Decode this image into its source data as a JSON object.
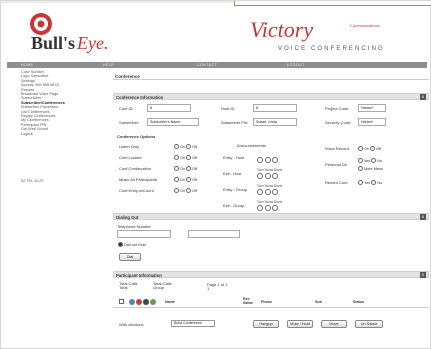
{
  "brand": {
    "logo_text": "Bull's Eye.",
    "partner_name": "Victory",
    "partner_tagline": "Communications",
    "partner_sub": "VOICE CONFERENCING",
    "accent_color": "#cc3333"
  },
  "nav": {
    "items": [
      "HOME",
      "HELP",
      "CONTACT",
      "LOGOUT"
    ]
  },
  "sidebar": {
    "items": [
      {
        "label": "Cust. Scratch",
        "selected": false
      },
      {
        "label": "Logo Subscriber",
        "selected": false
      },
      {
        "label": "Settings",
        "selected": false
      },
      {
        "label": "Access: 800 555 5678",
        "selected": false
      },
      {
        "label": "Reports",
        "selected": false
      },
      {
        "label": "Broadcast Voice Page",
        "selected": false
      },
      {
        "label": "Subscribers",
        "selected": false
      },
      {
        "label": "Subscriber/Conferences",
        "selected": true
      },
      {
        "label": "Subscriber Processes",
        "selected": false
      },
      {
        "label": "List Conferences",
        "selected": false
      },
      {
        "label": "Replay Conferences",
        "selected": false
      },
      {
        "label": "My Conferences",
        "selected": false
      },
      {
        "label": "Participant PIN",
        "selected": false
      },
      {
        "label": "Get Web Sound",
        "selected": false
      },
      {
        "label": "Logout",
        "selected": false
      }
    ],
    "status": "02 TEL 10-07"
  },
  "page": {
    "title": "Conference"
  },
  "conference_info": {
    "header": "Conference Information",
    "toggle": "x",
    "conf_id_label": "Conf ID:",
    "conf_id_value": "8",
    "host_id_label": "Host ID:",
    "host_id_value": "8",
    "project_code_label": "Project Code:",
    "project_code_value": "Harlan*",
    "subscriber_label": "Subscriber:",
    "subscriber_value": "Subscriber's Name",
    "subscriber_pin_label": "Subscriber Pin:",
    "subscriber_pin_value": "Sultan, Linda",
    "security_code_label": "Security Code:",
    "security_code_value": "Harlan*"
  },
  "conference_options": {
    "header": "Conference Options",
    "on": "On",
    "off": "Off",
    "listen_only": "Listen Only",
    "conf_locked": "Conf Locked",
    "conf_continuation": "Conf Continuation",
    "music_all": "Music All Participants",
    "conf_entry_exit": "Conf Entry w/Count",
    "announcements": "Announcements",
    "entry_host": "Entry - Host",
    "exit_host": "Exit - Host",
    "entry_group": "Entry - Group",
    "exit_group": "Exit - Group",
    "tone": "Tone",
    "name": "Name",
    "blank": "Blank",
    "voice_record": "Voice Record",
    "personal_dir": "Personal Dir",
    "yes": "Yes",
    "no": "No",
    "more_menu": "More Menu",
    "record_conf": "Record Conf"
  },
  "dialing": {
    "header": "Dialing Out",
    "phone_label": "Telephone Number",
    "phone_value": "",
    "option_label": "Dial out Host",
    "dial_button": "Dial"
  },
  "participants": {
    "header": "Participant Information",
    "total_count_label": "Total Calls Total",
    "group_label": "Total Calls Group",
    "page_label": "Page 1 of 1",
    "page_value": "1",
    "col_name": "Name",
    "col_num": "Rec Name",
    "col_phone": "Phone",
    "col_sub": "Sub",
    "col_status": "Status",
    "with_checked": "With checked:",
    "action_select": "Build Conference",
    "btn_hangup": "Hangup",
    "btn_mute": "Mute / Hold",
    "btn_move": "Move",
    "btn_select_all": "Un Select"
  }
}
